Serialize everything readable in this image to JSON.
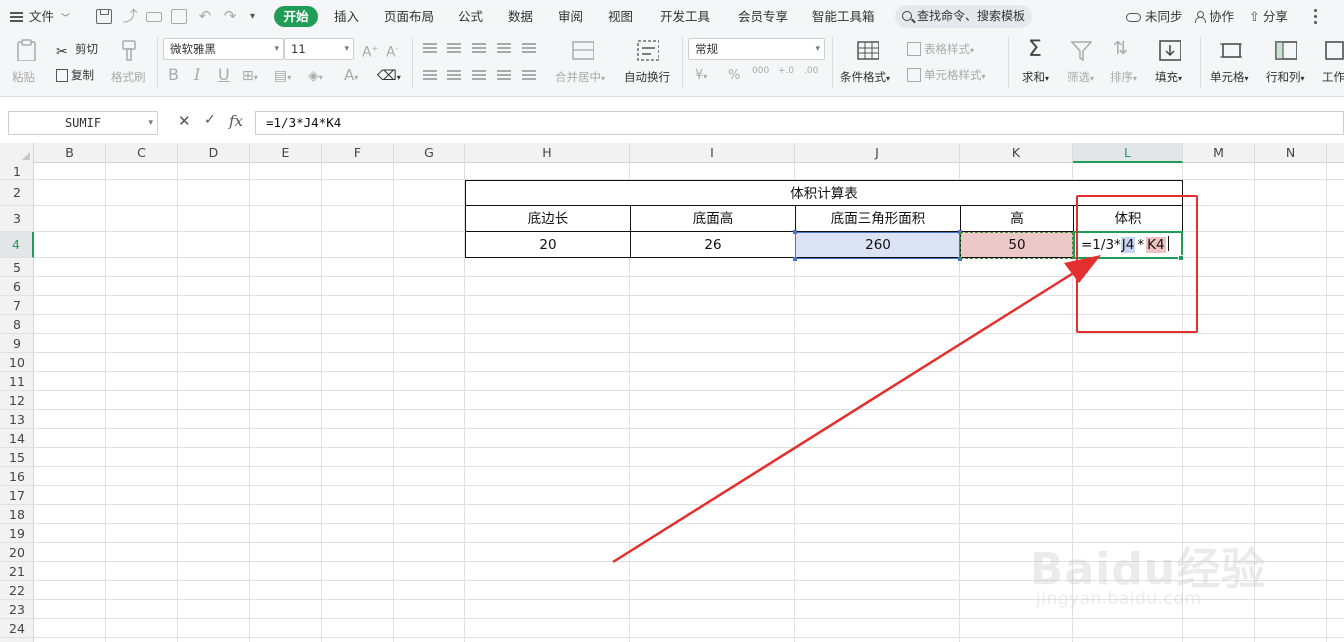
{
  "menu": {
    "file_label": "文件",
    "tabs": [
      {
        "label": "开始",
        "active": true
      },
      {
        "label": "插入"
      },
      {
        "label": "页面布局"
      },
      {
        "label": "公式"
      },
      {
        "label": "数据"
      },
      {
        "label": "审阅"
      },
      {
        "label": "视图"
      },
      {
        "label": "开发工具"
      },
      {
        "label": "会员专享"
      },
      {
        "label": "智能工具箱"
      }
    ],
    "search_text": "查找命令、搜索模板",
    "sync_label": "未同步",
    "collab_label": "协作",
    "share_label": "分享"
  },
  "ribbon": {
    "paste_label": "粘贴",
    "cut_label": "剪切",
    "copy_label": "复制",
    "format_painter_label": "格式刷",
    "font_name": "微软雅黑",
    "font_size": "11",
    "bold": "B",
    "italic": "I",
    "underline": "U",
    "merge_label": "合并居中",
    "wrap_label": "自动换行",
    "number_format": "常规",
    "currency": "¥",
    "percent": "%",
    "thousands": "000",
    "inc_decimal": "+.0",
    "dec_decimal": ".00",
    "cond_format_label": "条件格式",
    "table_style_label": "表格样式",
    "cell_style_label": "单元格样式",
    "sum_label": "求和",
    "filter_label": "筛选",
    "sort_label": "排序",
    "fill_label": "填充",
    "cell_label": "单元格",
    "rowcol_label": "行和列",
    "worksheet_label": "工作"
  },
  "formula_bar": {
    "name_box": "SUMIF",
    "cancel": "✕",
    "confirm": "✓",
    "fx": "fx",
    "formula": "=1/3*J4*K4"
  },
  "sheet": {
    "columns": [
      "B",
      "C",
      "D",
      "E",
      "F",
      "G",
      "H",
      "I",
      "J",
      "K",
      "L",
      "M",
      "N"
    ],
    "active_column": "L",
    "rows": [
      "1",
      "2",
      "3",
      "4",
      "5",
      "6",
      "7",
      "8",
      "9",
      "10",
      "11",
      "12",
      "13",
      "14",
      "15",
      "16",
      "17",
      "18",
      "19",
      "20",
      "21",
      "22",
      "23",
      "24"
    ],
    "active_row": "4",
    "table": {
      "title": "体积计算表",
      "headers": [
        "底边长",
        "底面高",
        "底面三角形面积",
        "高",
        "体积"
      ],
      "values": [
        "20",
        "26",
        "260",
        "50"
      ]
    },
    "edit": {
      "prefix": "=1/3*",
      "ref1": "J4",
      "op": "*",
      "ref2": "K4"
    }
  },
  "watermark": {
    "logo": "Baidu经验",
    "sub": "jingyan.baidu.com"
  },
  "colors": {
    "accent": "#1f9c55",
    "callout": "#e52e2e",
    "ref_blue": "#4a74c9",
    "ref_red": "#ecc8c8"
  }
}
